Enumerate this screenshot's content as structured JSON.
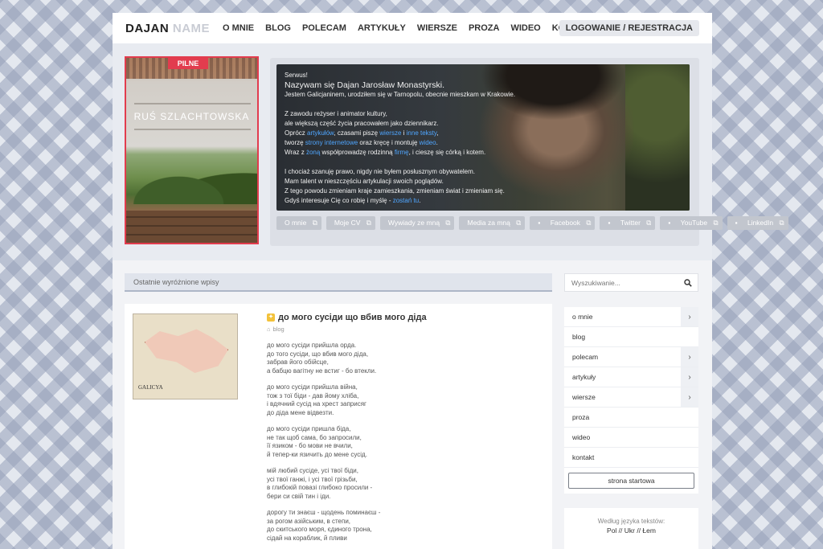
{
  "header": {
    "logo_a": "DAJAN",
    "logo_b": "NAME",
    "nav": [
      "O MNIE",
      "BLOG",
      "POLECAM",
      "ARTYKUŁY",
      "WIERSZE",
      "PROZA",
      "WIDEO",
      "KONTAKT"
    ],
    "login": "LOGOWANIE / REJESTRACJA"
  },
  "poster": {
    "badge": "PILNE",
    "title": "RUŚ SZLACHTOWSKA"
  },
  "bio": {
    "greeting": "Serwus!",
    "intro_prefix": "Nazywam się ",
    "name": "Dajan Jarosław Monastyrski",
    "intro_suffix": ".",
    "line2": "Jestem Galicjaninem, urodziłem się w Tarnopolu, obecnie mieszkam w Krakowie.",
    "p2_l1": "Z zawodu reżyser i animator kultury,",
    "p2_l2": "ale większą część życia pracowałem jako dziennikarz.",
    "p2_l3a": "Oprócz ",
    "p2_l3_link1": "artykułów",
    "p2_l3b": ", czasami piszę ",
    "p2_l3_link2": "wiersze",
    "p2_l3c": " i ",
    "p2_l3_link3": "inne teksty",
    "p2_l3d": ",",
    "p2_l4a": "tworzę ",
    "p2_l4_link1": "strony internetowe",
    "p2_l4b": " oraz kręcę i montuję ",
    "p2_l4_link2": "wideo",
    "p2_l4c": ".",
    "p2_l5a": "Wraz z ",
    "p2_l5_link1": "żoną",
    "p2_l5b": " współprowadzę rodzinną ",
    "p2_l5_link2": "firmę",
    "p2_l5c": ", i cieszę się córką i kotem.",
    "p3_l1": "I chociaż szanuję prawo, nigdy nie byłem posłusznym obywatelem.",
    "p3_l2": "Mam talent w nieszczęściu artykulacji swoich poglądów.",
    "p3_l3": "Z tego powodu zmieniam kraje zamieszkania, zmieniam świat i zmieniam się.",
    "p3_l4a": "Gdyś interesuje Cię co robię i myślę - ",
    "p3_l4_link": "zostań tu",
    "p3_l4b": "."
  },
  "social": [
    "O mnie",
    "Moje CV",
    "Wywiady ze mną",
    "Media za mną",
    "Facebook",
    "Twitter",
    "YouTube",
    "LinkedIn"
  ],
  "posts": {
    "section_title": "Ostatnie wyróżnione wpisy",
    "map_label": "GALICYA",
    "title": "до мого сусіди що вбив мого діда",
    "category": "blog",
    "stanzas": [
      [
        "до мого сусіди прийшла орда.",
        "до того сусіди, що вбив мого діда,",
        "забрав його обійсце,",
        "а бабцю вагітну не встиг - бо втекли."
      ],
      [
        "до мого сусіди прийшла війна,",
        "тож з тої біди - дав йому хліба,",
        "і вдячний сусід на хрест заприсяг",
        "до діда мене відвезти."
      ],
      [
        "до мого сусіди пришла біда,",
        "не так щоб сама, бо запросили,",
        "її язиком - бо мови не вчили,",
        "й тепер-ки язичить до мене сусід."
      ],
      [
        "мій любий сусіде, усі твої біди,",
        "усі твої ганжі, і усі твої грізьби,",
        "в глибокій повазі глибоко просили -",
        "бери си свій тин і іди."
      ],
      [
        "дорогу ти знаєш - щодень поминаєш -",
        "за рогом азійським, в степи,",
        "до скитського моря, єдиного трона,",
        "сідай на кораблик, й пливи"
      ]
    ]
  },
  "sidebar": {
    "search_placeholder": "Wyszukiwanie...",
    "menu": [
      {
        "label": "o mnie",
        "expand": true
      },
      {
        "label": "blog",
        "expand": false
      },
      {
        "label": "polecam",
        "expand": true
      },
      {
        "label": "artykuły",
        "expand": true
      },
      {
        "label": "wiersze",
        "expand": true
      },
      {
        "label": "proza",
        "expand": false
      },
      {
        "label": "wideo",
        "expand": false
      },
      {
        "label": "kontakt",
        "expand": false
      }
    ],
    "start_button": "strona startowa",
    "lang_title": "Według języka tekstów:",
    "lang_values": "Pol // Ukr // Łem"
  },
  "colors": {
    "accent_red": "#e23c4e",
    "link_blue": "#4fa6ff",
    "pin_yellow": "#f3c23a"
  }
}
